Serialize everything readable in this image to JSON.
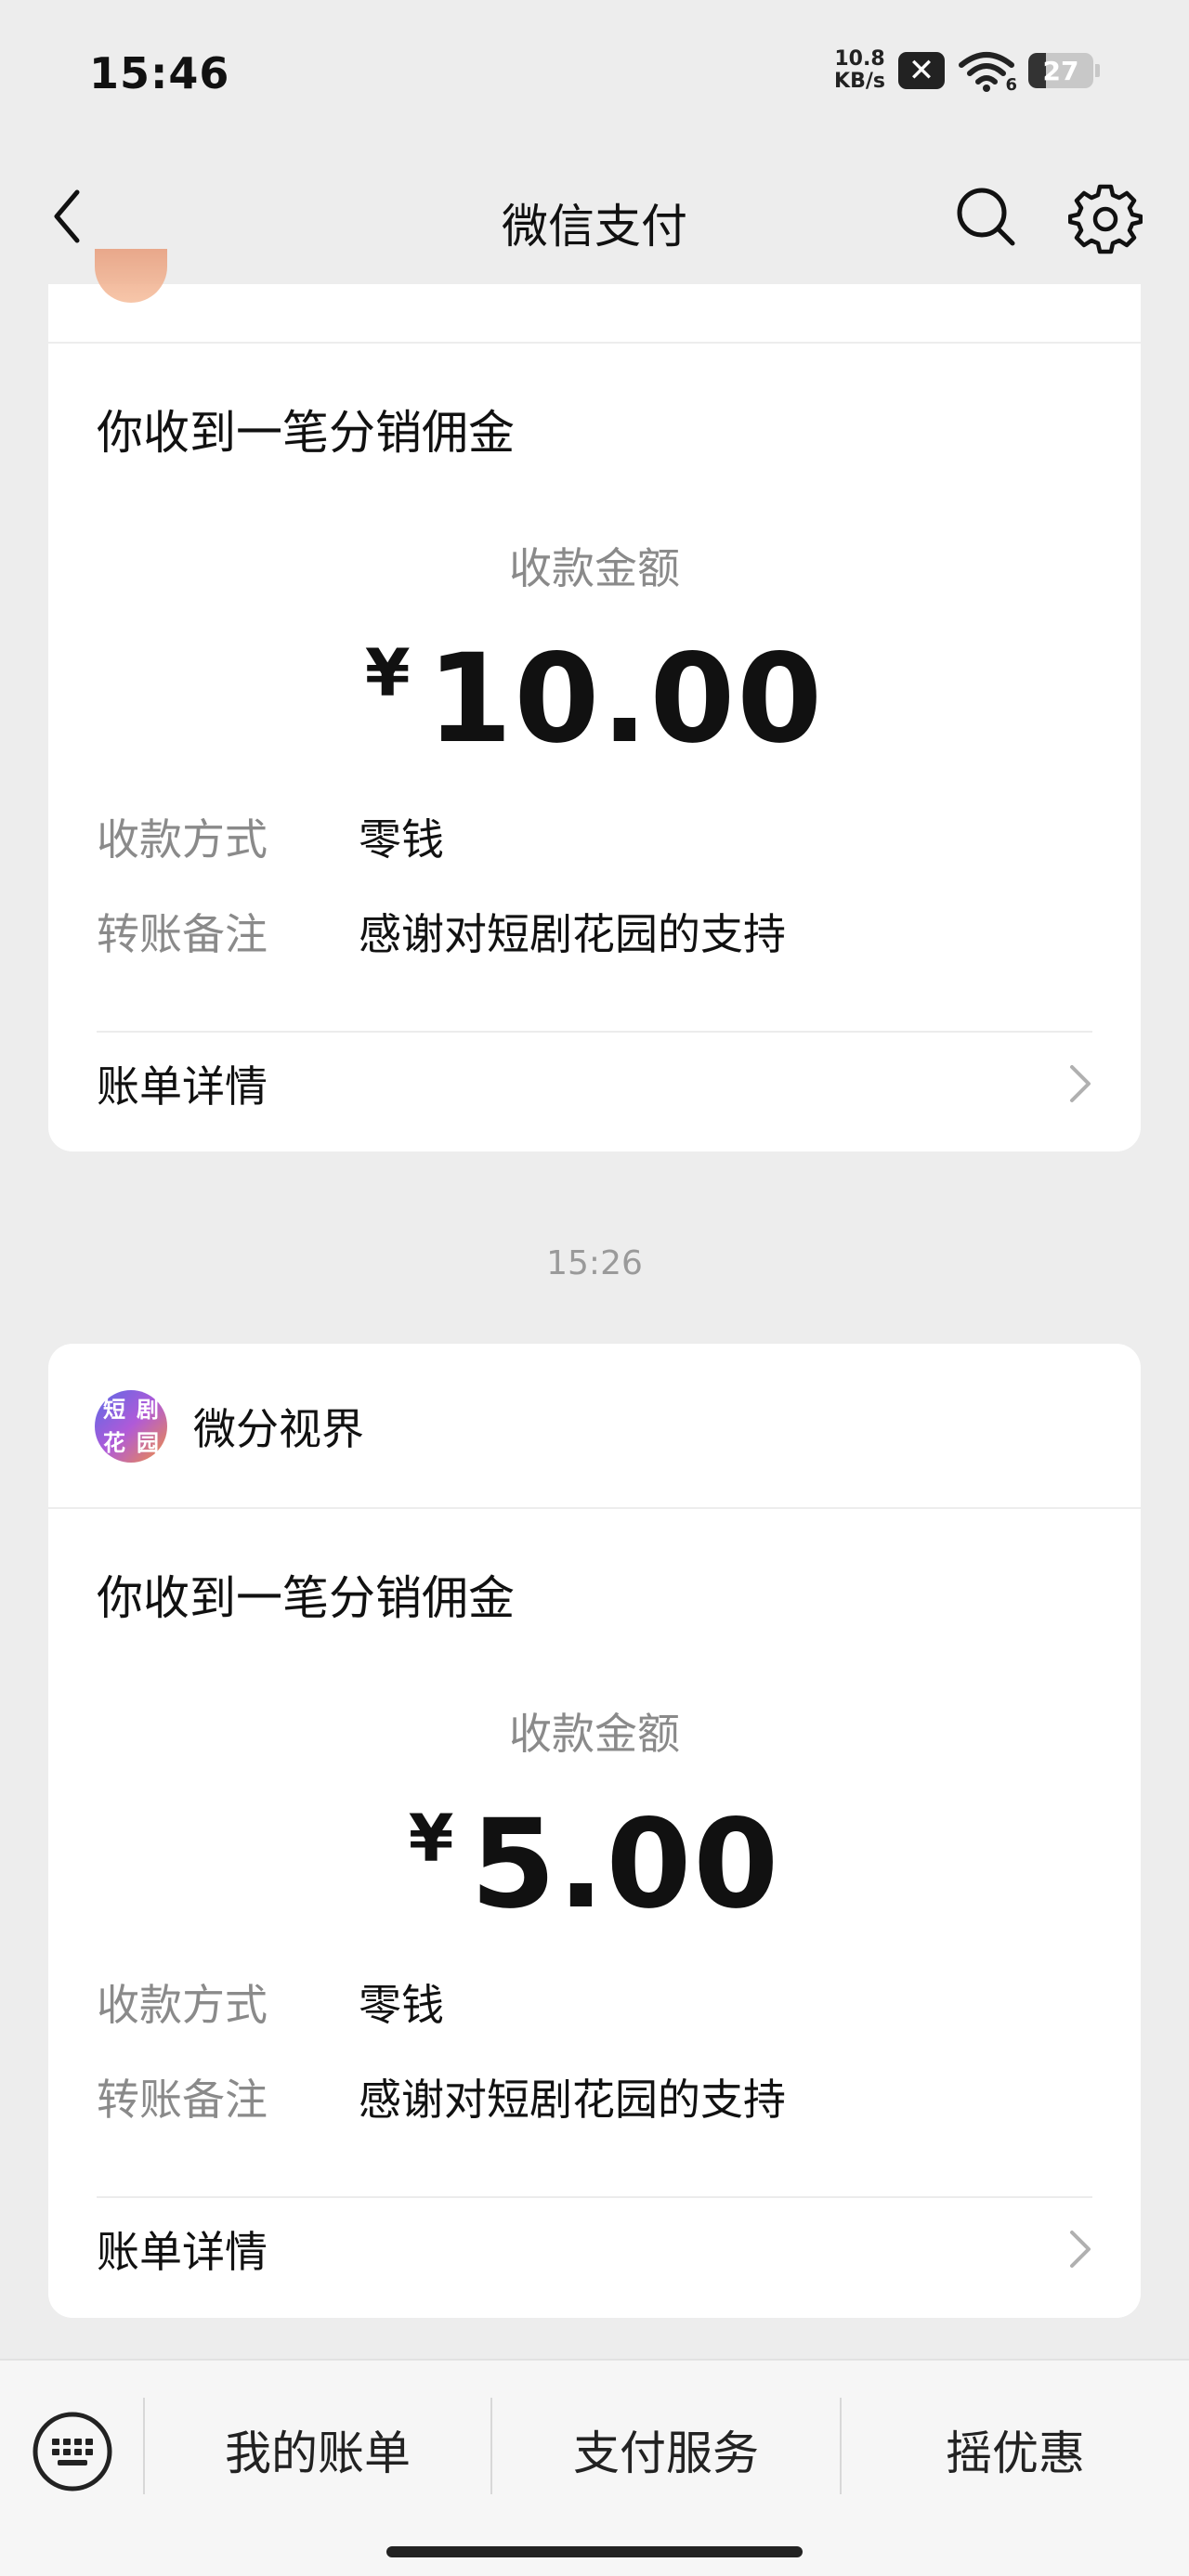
{
  "status_bar": {
    "time": "15:46",
    "net_speed_value": "10.8",
    "net_speed_unit": "KB/s",
    "wifi_label": "6",
    "battery_level": "27",
    "battery_fraction": 0.27
  },
  "nav": {
    "title": "微信支付",
    "icons": [
      "back-icon",
      "search-icon",
      "gear-icon"
    ]
  },
  "messages": [
    {
      "title": "你收到一笔分销佣金",
      "amount_label": "收款金额",
      "currency": "¥",
      "amount": "10.00",
      "method_label": "收款方式",
      "method": "零钱",
      "remark_label": "转账备注",
      "remark": "感谢对短剧花园的支持",
      "detail_label": "账单详情"
    },
    {
      "timestamp": "15:26",
      "sender_name": "微分视界",
      "sender_logo_chars": [
        "短",
        "剧",
        "花",
        "园"
      ],
      "title": "你收到一笔分销佣金",
      "amount_label": "收款金额",
      "currency": "¥",
      "amount": "5.00",
      "method_label": "收款方式",
      "method": "零钱",
      "remark_label": "转账备注",
      "remark": "感谢对短剧花园的支持",
      "detail_label": "账单详情"
    }
  ],
  "bottom_bar": {
    "tabs": [
      "我的账单",
      "支付服务",
      "摇优惠"
    ],
    "keyboard_icon": "keyboard-icon"
  },
  "colors": {
    "background": "#ededed",
    "card": "#ffffff",
    "secondary_text": "#8a8a8a"
  }
}
